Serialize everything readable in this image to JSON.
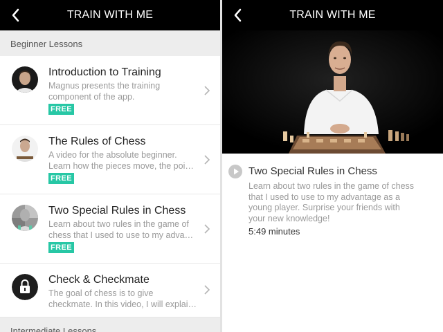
{
  "left_screen": {
    "header": {
      "title": "TRAIN WITH ME",
      "back_icon": "chevron-left-icon"
    },
    "sections": [
      {
        "label": "Beginner Lessons"
      },
      {
        "label": "Intermediate Lessons"
      }
    ],
    "lessons": [
      {
        "title": "Introduction to Training",
        "description_lines": [
          "Magnus presents the training",
          "component of the app."
        ],
        "badge": "FREE",
        "avatar": "magnus-portrait"
      },
      {
        "title": "The Rules of Chess",
        "description_lines": [
          "A video for the absolute beginner.",
          "Learn how the pieces move, the poi…"
        ],
        "badge": "FREE",
        "avatar": "magnus-portrait"
      },
      {
        "title": "Two Special Rules in Chess",
        "description_lines": [
          "Learn about two rules in the game of",
          "chess that I used to use to my adva…"
        ],
        "badge": "FREE",
        "avatar": "magnus-grey-portrait"
      },
      {
        "title": "Check & Checkmate",
        "description_lines": [
          "The goal of chess is to give",
          "checkmate. In this video, I will explai…"
        ],
        "badge": "",
        "avatar": "lock-icon"
      }
    ]
  },
  "right_screen": {
    "header": {
      "title": "TRAIN WITH ME",
      "back_icon": "chevron-left-icon"
    },
    "now_playing": {
      "title": "Two Special Rules in Chess",
      "description_lines": [
        "Learn about two rules in the game of chess",
        "that I used to use to my advantage as a",
        "young player. Surprise your friends with",
        "your new knowledge!"
      ],
      "duration": "5:49 minutes"
    }
  },
  "colors": {
    "header_bg": "#000000",
    "free_badge": "#27c7a5",
    "section_bg": "#ededed"
  }
}
